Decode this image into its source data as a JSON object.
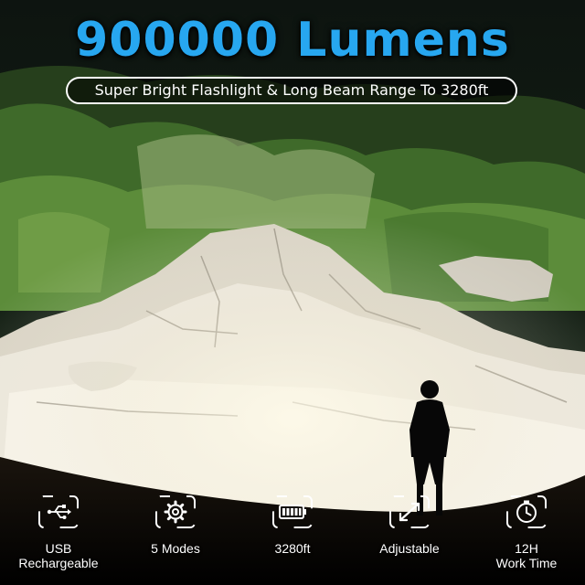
{
  "headline": "900000 Lumens",
  "subheadline": "Super Bright Flashlight & Long Beam Range To 3280ft",
  "features": [
    {
      "icon": "usb-icon",
      "label_lines": [
        "USB",
        "Rechargeable"
      ]
    },
    {
      "icon": "gear-icon",
      "label_lines": [
        "5 Modes"
      ]
    },
    {
      "icon": "battery-icon",
      "label_lines": [
        "3280ft"
      ]
    },
    {
      "icon": "zoom-expand-icon",
      "label_lines": [
        "Adjustable"
      ]
    },
    {
      "icon": "timer-icon",
      "label_lines": [
        "12H",
        "Work Time"
      ]
    }
  ],
  "colors": {
    "headline": "#27a7f0",
    "text": "#ffffff",
    "rock": "#e8e4d9",
    "foliage": "#3f6a2a"
  }
}
